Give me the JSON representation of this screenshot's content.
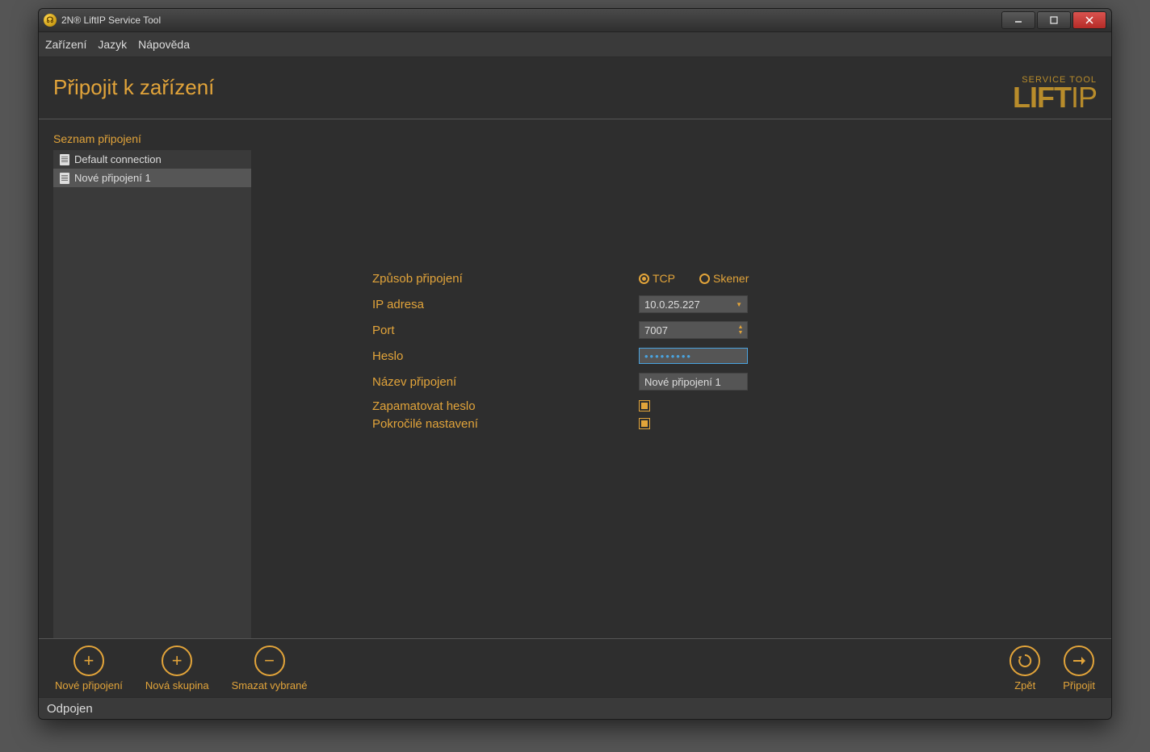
{
  "window": {
    "title": "2N® LiftIP Service Tool"
  },
  "menu": {
    "device": "Zařízení",
    "language": "Jazyk",
    "help": "Nápověda"
  },
  "header": {
    "page_title": "Připojit k zařízení",
    "logo_small": "SERVICE TOOL",
    "logo_big": "LIFT",
    "logo_suffix": "IP"
  },
  "sidebar": {
    "title": "Seznam připojení",
    "items": [
      {
        "label": "Default connection",
        "selected": false
      },
      {
        "label": "Nové připojení 1",
        "selected": true
      }
    ]
  },
  "form": {
    "method_label": "Způsob připojení",
    "radio_tcp": "TCP",
    "radio_scanner": "Skener",
    "ip_label": "IP adresa",
    "ip_value": "10.0.25.227",
    "port_label": "Port",
    "port_value": "7007",
    "password_label": "Heslo",
    "password_value": "•••••••••",
    "name_label": "Název připojení",
    "name_value": "Nové připojení 1",
    "remember_label": "Zapamatovat heslo",
    "advanced_label": "Pokročilé nastavení"
  },
  "toolbar": {
    "new_conn": "Nové připojení",
    "new_group": "Nová skupina",
    "delete_sel": "Smazat vybrané",
    "back": "Zpět",
    "connect": "Připojit"
  },
  "status": {
    "text": "Odpojen"
  }
}
